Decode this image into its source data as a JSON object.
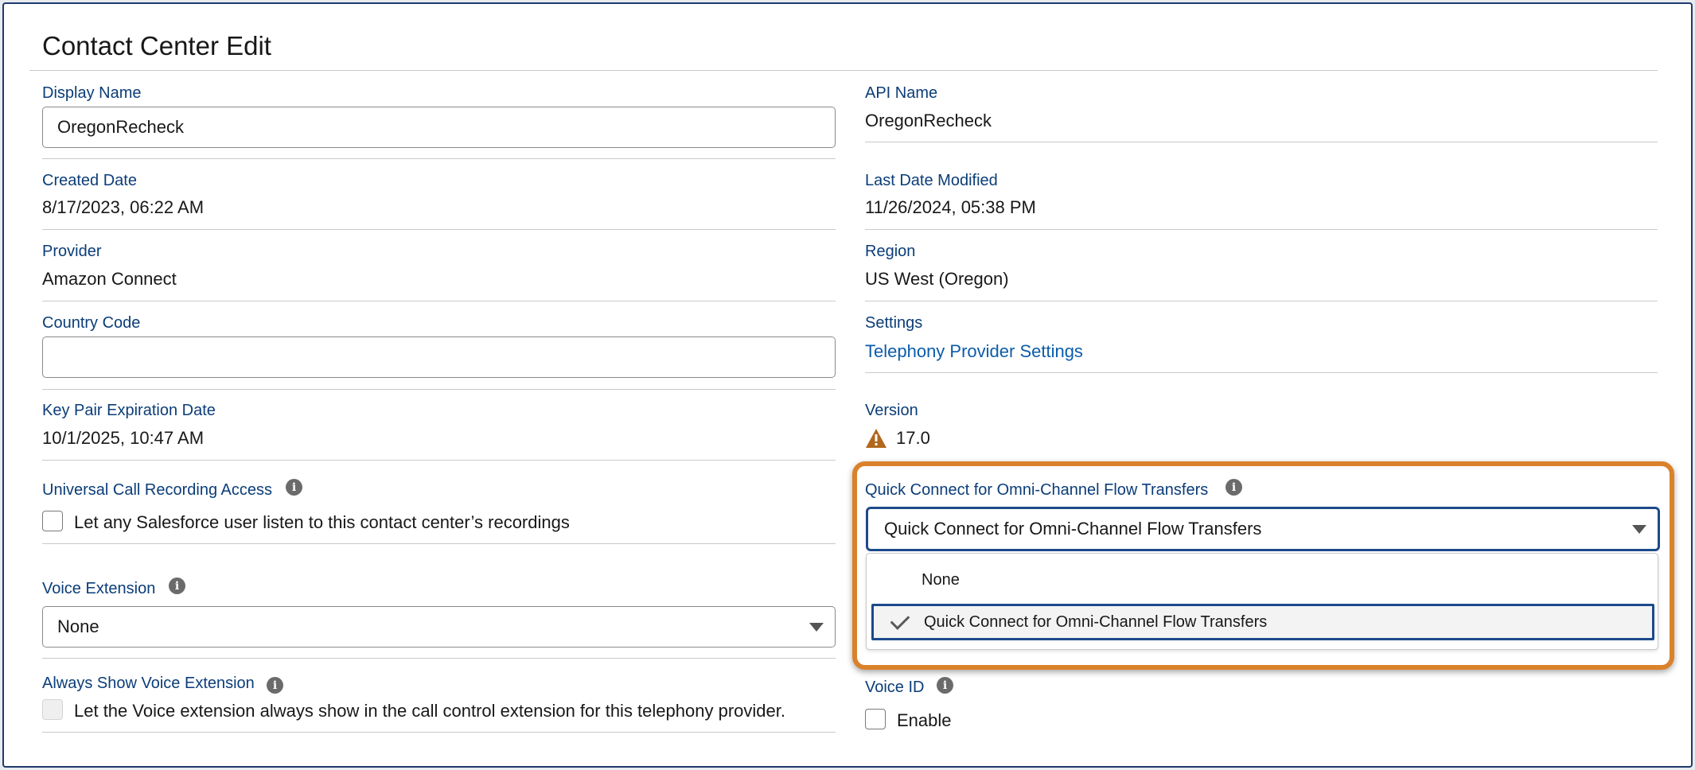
{
  "page": {
    "title": "Contact Center Edit"
  },
  "left": {
    "display_name": {
      "label": "Display Name",
      "value": "OregonRecheck"
    },
    "created_date": {
      "label": "Created Date",
      "value": "8/17/2023, 06:22 AM"
    },
    "provider": {
      "label": "Provider",
      "value": "Amazon Connect"
    },
    "country_code": {
      "label": "Country Code",
      "value": ""
    },
    "key_pair": {
      "label": "Key Pair Expiration Date",
      "value": "10/1/2025, 10:47 AM"
    },
    "universal_call": {
      "label": "Universal Call Recording Access",
      "checkbox_label": "Let any Salesforce user listen to this contact center’s recordings",
      "checked": false
    },
    "voice_extension": {
      "label": "Voice Extension",
      "value": "None"
    },
    "always_show": {
      "label": "Always Show Voice Extension",
      "checkbox_label": "Let the Voice extension always show in the call control extension for this telephony provider.",
      "disabled": true
    }
  },
  "right": {
    "api_name": {
      "label": "API Name",
      "value": "OregonRecheck"
    },
    "last_modified": {
      "label": "Last Date Modified",
      "value": "11/26/2024, 05:38 PM"
    },
    "region": {
      "label": "Region",
      "value": "US West (Oregon)"
    },
    "settings": {
      "label": "Settings",
      "link": "Telephony Provider Settings"
    },
    "version": {
      "label": "Version",
      "value": "17.0"
    },
    "quick_connect": {
      "label": "Quick Connect for Omni-Channel Flow Transfers",
      "selected": "Quick Connect for Omni-Channel Flow Transfers",
      "options": [
        "None",
        "Quick Connect for Omni-Channel Flow Transfers"
      ]
    },
    "voice_id": {
      "label": "Voice ID",
      "checkbox_label": "Enable",
      "checked": false
    }
  },
  "colors": {
    "label": "#0b3d78",
    "link": "#0b5cab",
    "highlight": "#d9822b",
    "focus": "#1c4a8a",
    "warning": "#b2671b"
  },
  "icons": {
    "info": "info-icon",
    "warning": "warning-icon",
    "caret": "chevron-down-icon",
    "check": "check-icon"
  }
}
